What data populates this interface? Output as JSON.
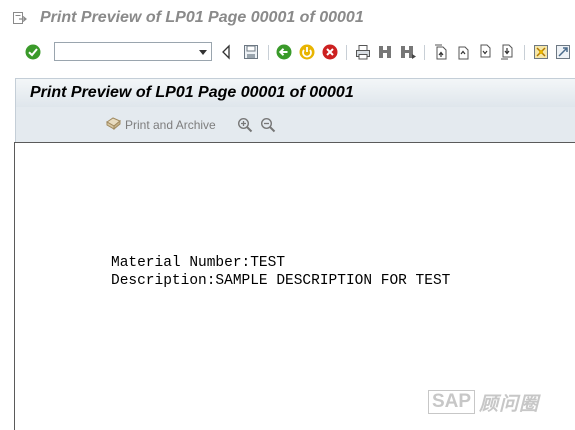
{
  "window": {
    "title": "Print Preview of LP01 Page 00001 of 00001"
  },
  "toolbar": {
    "command_field_value": "",
    "buttons": [
      "enter-icon",
      "back-nav-icon",
      "save-icon",
      "back-icon",
      "exit-icon",
      "cancel-icon",
      "print-icon",
      "find-icon",
      "find-next-icon",
      "first-page-icon",
      "previous-page-icon",
      "next-page-icon",
      "last-page-icon",
      "customize-layout-icon",
      "help-icon"
    ]
  },
  "header": {
    "title": "Print Preview of LP01 Page 00001 of 00001"
  },
  "application_toolbar": {
    "print_and_archive_label": "Print and Archive",
    "zoom_in_icon": "zoom-in-icon",
    "zoom_out_icon": "zoom-out-icon"
  },
  "document": {
    "lines": [
      "Material Number:TEST",
      "Description:SAMPLE DESCRIPTION FOR TEST"
    ]
  },
  "watermark": {
    "brand": "SAP",
    "suffix": "顾问圈"
  },
  "colors": {
    "title_gray": "#8a8a8a",
    "header_bar": "#dfe6ec",
    "app_bar": "#e4eaef",
    "enter_green": "#3a9a2a",
    "exit_yellow": "#e8b400",
    "cancel_red": "#cc2020"
  }
}
